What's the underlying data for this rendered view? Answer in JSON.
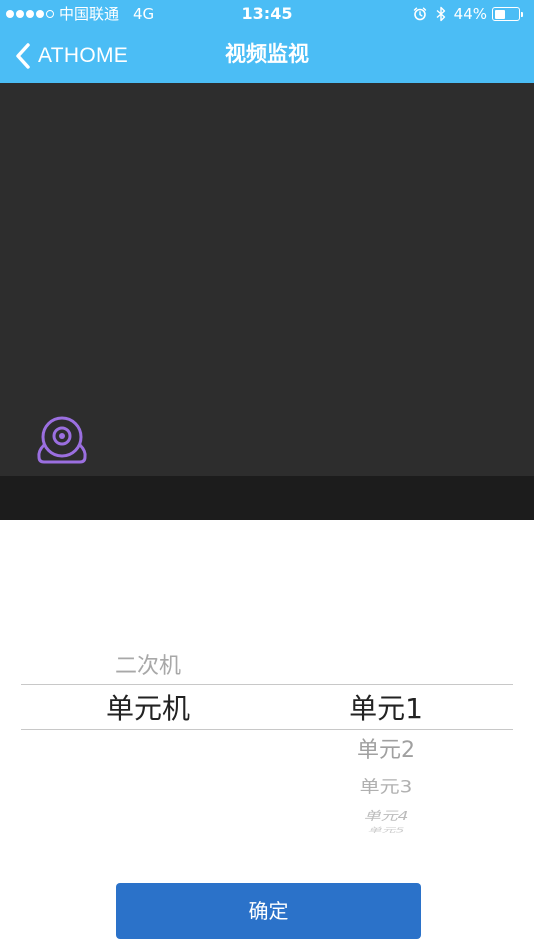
{
  "status_bar": {
    "carrier": "中国联通",
    "network": "4G",
    "time": "13:45",
    "battery_percent_label": "44%",
    "battery_level": 0.44,
    "signal_bars_filled": 4,
    "signal_bars_total": 5,
    "icons": [
      "alarm-icon",
      "bluetooth-icon",
      "battery-icon"
    ]
  },
  "nav": {
    "back_label": "ATHOME",
    "title": "视频监视",
    "back_icon": "chevron-left-icon"
  },
  "video": {
    "camera_icon": "camera-icon",
    "camera_icon_color": "#9b6fe0"
  },
  "picker": {
    "left_column": {
      "above": "二次机",
      "selected": "单元机"
    },
    "right_column": {
      "selected": "单元1",
      "below": [
        "单元2",
        "单元3",
        "单元4",
        "单元5"
      ]
    }
  },
  "confirm_button": {
    "label": "确定"
  },
  "colors": {
    "nav_background": "#4bbdf5",
    "video_background": "#2d2d2d",
    "video_footer": "#1c1c1c",
    "confirm_button": "#2b72c9"
  }
}
